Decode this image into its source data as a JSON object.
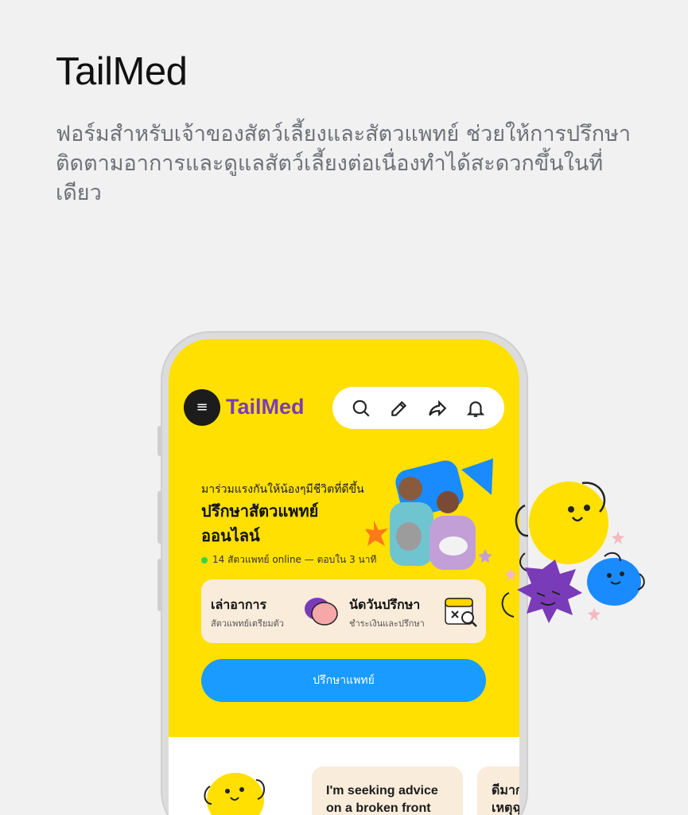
{
  "page": {
    "title": "TailMed",
    "description": "ฟอร์มสำหรับเจ้าของสัตว์เลี้ยงและสัตวแพทย์ ช่วยให้การปรึกษา ติดตามอาการและดูแลสัตว์เลี้ยงต่อเนื่องทำได้สะดวกขึ้นในที่เดียว"
  },
  "app": {
    "logo_text": "TailMed",
    "menu_icon": "≡",
    "toolbar": {
      "icons": [
        "search-icon",
        "edit-icon",
        "share-icon",
        "bell-icon"
      ]
    },
    "hero": {
      "subtitle": "มาร่วมแรงกันให้น้องๆมีชีวิตที่ดีขึ้น",
      "title": "ปรึกษาสัตวแพทย์ ออนไลน์",
      "status": "14 สัตวแพทย์ online — ตอบใน 3 นาที",
      "status_color": "#3ad14f"
    },
    "actions": {
      "describe": {
        "title": "เล่าอาการ",
        "sub": "สัตวแพทย์เตรียมตัว"
      },
      "appointment": {
        "title": "นัดวันปรึกษา",
        "sub": "ชำระเงินและปรึกษา"
      }
    },
    "cta_label": "ปรึกษาแพทย์",
    "chat_cards": [
      "I'm seeking advice on a broken front",
      "ดีมาก เหตุฉุ"
    ],
    "colors": {
      "brand_yellow": "#ffe000",
      "brand_purple": "#7a3bb8",
      "cta_blue": "#1a9bff",
      "card_bg": "#f9ecdb"
    }
  }
}
